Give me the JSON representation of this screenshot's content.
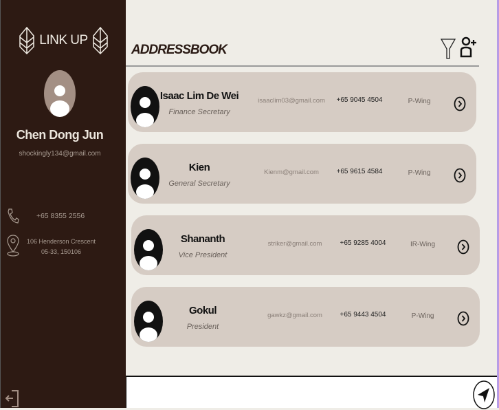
{
  "app": {
    "name": "LINK UP"
  },
  "profile": {
    "name": "Chen Dong Jun",
    "email": "shockingly134@gmail.com",
    "phone": "+65 8355 2556",
    "address_line1": "106 Henderson Crescent",
    "address_line2": "05-33, 150106"
  },
  "header": {
    "title": "ADDRESSBOOK"
  },
  "contacts": [
    {
      "name": "Isaac Lim De Wei",
      "role": "Finance Secretary",
      "email": "isaaclim03@gmail.com",
      "phone": "+65 9045 4504",
      "wing": "P-Wing"
    },
    {
      "name": "Kien",
      "role": "General Secretary",
      "email": "Kienm@gmail.com",
      "phone": "+65 9615 4584",
      "wing": "P-Wing"
    },
    {
      "name": "Shananth",
      "role": "Vice President",
      "email": "striker@gmail.com",
      "phone": "+65 9285 4004",
      "wing": "IR-Wing"
    },
    {
      "name": "Gokul",
      "role": "President",
      "email": "gawkz@gmail.com",
      "phone": "+65 9443 4504",
      "wing": "P-Wing"
    }
  ],
  "colors": {
    "sidebar": "#2d1a13",
    "card": "#d6ccc4",
    "background": "#efede7"
  }
}
